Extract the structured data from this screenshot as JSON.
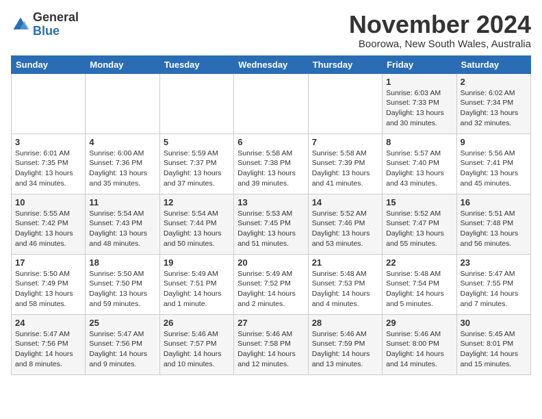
{
  "logo": {
    "general": "General",
    "blue": "Blue"
  },
  "title": "November 2024",
  "subtitle": "Boorowa, New South Wales, Australia",
  "weekdays": [
    "Sunday",
    "Monday",
    "Tuesday",
    "Wednesday",
    "Thursday",
    "Friday",
    "Saturday"
  ],
  "weeks": [
    [
      {
        "day": "",
        "detail": ""
      },
      {
        "day": "",
        "detail": ""
      },
      {
        "day": "",
        "detail": ""
      },
      {
        "day": "",
        "detail": ""
      },
      {
        "day": "",
        "detail": ""
      },
      {
        "day": "1",
        "detail": "Sunrise: 6:03 AM\nSunset: 7:33 PM\nDaylight: 13 hours\nand 30 minutes."
      },
      {
        "day": "2",
        "detail": "Sunrise: 6:02 AM\nSunset: 7:34 PM\nDaylight: 13 hours\nand 32 minutes."
      }
    ],
    [
      {
        "day": "3",
        "detail": "Sunrise: 6:01 AM\nSunset: 7:35 PM\nDaylight: 13 hours\nand 34 minutes."
      },
      {
        "day": "4",
        "detail": "Sunrise: 6:00 AM\nSunset: 7:36 PM\nDaylight: 13 hours\nand 35 minutes."
      },
      {
        "day": "5",
        "detail": "Sunrise: 5:59 AM\nSunset: 7:37 PM\nDaylight: 13 hours\nand 37 minutes."
      },
      {
        "day": "6",
        "detail": "Sunrise: 5:58 AM\nSunset: 7:38 PM\nDaylight: 13 hours\nand 39 minutes."
      },
      {
        "day": "7",
        "detail": "Sunrise: 5:58 AM\nSunset: 7:39 PM\nDaylight: 13 hours\nand 41 minutes."
      },
      {
        "day": "8",
        "detail": "Sunrise: 5:57 AM\nSunset: 7:40 PM\nDaylight: 13 hours\nand 43 minutes."
      },
      {
        "day": "9",
        "detail": "Sunrise: 5:56 AM\nSunset: 7:41 PM\nDaylight: 13 hours\nand 45 minutes."
      }
    ],
    [
      {
        "day": "10",
        "detail": "Sunrise: 5:55 AM\nSunset: 7:42 PM\nDaylight: 13 hours\nand 46 minutes."
      },
      {
        "day": "11",
        "detail": "Sunrise: 5:54 AM\nSunset: 7:43 PM\nDaylight: 13 hours\nand 48 minutes."
      },
      {
        "day": "12",
        "detail": "Sunrise: 5:54 AM\nSunset: 7:44 PM\nDaylight: 13 hours\nand 50 minutes."
      },
      {
        "day": "13",
        "detail": "Sunrise: 5:53 AM\nSunset: 7:45 PM\nDaylight: 13 hours\nand 51 minutes."
      },
      {
        "day": "14",
        "detail": "Sunrise: 5:52 AM\nSunset: 7:46 PM\nDaylight: 13 hours\nand 53 minutes."
      },
      {
        "day": "15",
        "detail": "Sunrise: 5:52 AM\nSunset: 7:47 PM\nDaylight: 13 hours\nand 55 minutes."
      },
      {
        "day": "16",
        "detail": "Sunrise: 5:51 AM\nSunset: 7:48 PM\nDaylight: 13 hours\nand 56 minutes."
      }
    ],
    [
      {
        "day": "17",
        "detail": "Sunrise: 5:50 AM\nSunset: 7:49 PM\nDaylight: 13 hours\nand 58 minutes."
      },
      {
        "day": "18",
        "detail": "Sunrise: 5:50 AM\nSunset: 7:50 PM\nDaylight: 13 hours\nand 59 minutes."
      },
      {
        "day": "19",
        "detail": "Sunrise: 5:49 AM\nSunset: 7:51 PM\nDaylight: 14 hours\nand 1 minute."
      },
      {
        "day": "20",
        "detail": "Sunrise: 5:49 AM\nSunset: 7:52 PM\nDaylight: 14 hours\nand 2 minutes."
      },
      {
        "day": "21",
        "detail": "Sunrise: 5:48 AM\nSunset: 7:53 PM\nDaylight: 14 hours\nand 4 minutes."
      },
      {
        "day": "22",
        "detail": "Sunrise: 5:48 AM\nSunset: 7:54 PM\nDaylight: 14 hours\nand 5 minutes."
      },
      {
        "day": "23",
        "detail": "Sunrise: 5:47 AM\nSunset: 7:55 PM\nDaylight: 14 hours\nand 7 minutes."
      }
    ],
    [
      {
        "day": "24",
        "detail": "Sunrise: 5:47 AM\nSunset: 7:56 PM\nDaylight: 14 hours\nand 8 minutes."
      },
      {
        "day": "25",
        "detail": "Sunrise: 5:47 AM\nSunset: 7:56 PM\nDaylight: 14 hours\nand 9 minutes."
      },
      {
        "day": "26",
        "detail": "Sunrise: 5:46 AM\nSunset: 7:57 PM\nDaylight: 14 hours\nand 10 minutes."
      },
      {
        "day": "27",
        "detail": "Sunrise: 5:46 AM\nSunset: 7:58 PM\nDaylight: 14 hours\nand 12 minutes."
      },
      {
        "day": "28",
        "detail": "Sunrise: 5:46 AM\nSunset: 7:59 PM\nDaylight: 14 hours\nand 13 minutes."
      },
      {
        "day": "29",
        "detail": "Sunrise: 5:46 AM\nSunset: 8:00 PM\nDaylight: 14 hours\nand 14 minutes."
      },
      {
        "day": "30",
        "detail": "Sunrise: 5:45 AM\nSunset: 8:01 PM\nDaylight: 14 hours\nand 15 minutes."
      }
    ]
  ]
}
